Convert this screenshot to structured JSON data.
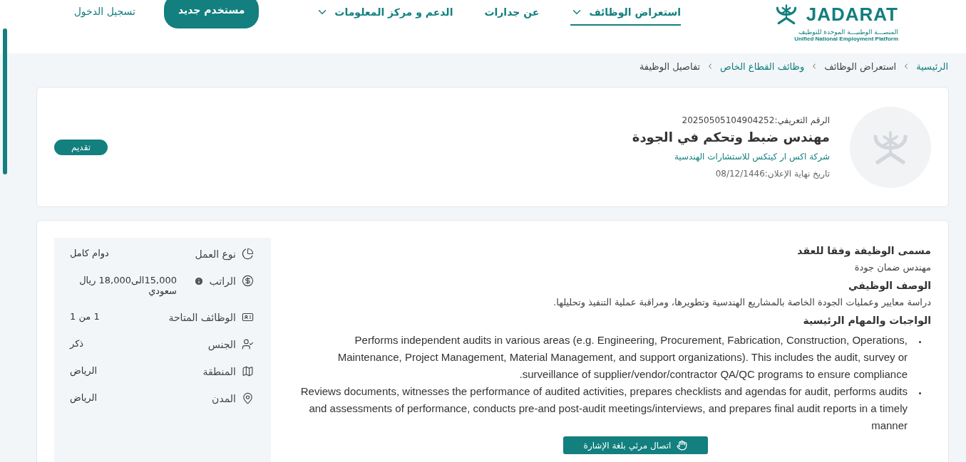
{
  "header": {
    "logo": {
      "wordmark": "JADARAT",
      "subtitle_ar": "المنصـــة الوطنيـــة الموحدة للتوظيف",
      "subtitle_en": "Unified National Employment Platform"
    },
    "nav": [
      {
        "label": "استعراض الوظائف",
        "selected": true,
        "dropdown": true
      },
      {
        "label": "عن جدارات",
        "selected": false,
        "dropdown": false
      },
      {
        "label": "الدعم و مركز المعلومات",
        "selected": false,
        "dropdown": true
      }
    ],
    "register_button": "مستخدم جديد",
    "login_link": "تسجيل الدخول"
  },
  "breadcrumb": [
    {
      "label": "الرئيسية",
      "kind": "link"
    },
    {
      "label": "استعراض الوظائف",
      "kind": "plain"
    },
    {
      "label": "وظائف القطاع الخاص",
      "kind": "link"
    },
    {
      "label": "تفاصيل الوظيفة",
      "kind": "current"
    }
  ],
  "job": {
    "reference": "الرقم التعريفي:20250505104904252",
    "title": "مهندس ضبط وتحكم في الجودة",
    "company": "شركة اكس ار كيتكس للاستشارات الهندسية",
    "deadline": "تاريخ نهاية الإعلان:08/12/1446",
    "apply_button": "تقديم"
  },
  "details": {
    "sections": [
      {
        "heading": "مسمى الوظيفة وفقا للعقد",
        "kind": "text",
        "text": "مهندس ضمان جودة"
      },
      {
        "heading": "الوصف الوظيفي",
        "kind": "text",
        "text": "دراسة معايير وعمليات الجودة الخاصة بالمشاريع الهندسية وتطويرها، ومراقبة عملية التنفيذ وتحليلها."
      },
      {
        "heading": "الواجبات والمهام الرئيسية",
        "kind": "bullets",
        "items": [
          "Performs independent audits in various areas (e.g. Engineering, Procurement, Fabrication, Construction, Operations, Maintenance, Project Management, Material Management, and support organizations). This includes the audit, survey or surveillance of supplier/vendor/contractor QA/QC programs to ensure compliance.",
          "Reviews documents, witnesses the performance of audited activities, prepares checklists and agendas for audit, performs audits and assessments of performance, conducts pre-and post-audit meetings/interviews, and prepares final audit reports in a timely manner"
        ]
      }
    ]
  },
  "summary": [
    {
      "kind": "work-type",
      "label": "نوع العمل",
      "value": "دوام كامل"
    },
    {
      "kind": "salary",
      "label": "الراتب",
      "value": "15,000الى18,000 ريال سعودي",
      "info": true
    },
    {
      "kind": "vacancies",
      "label": "الوظائف المتاحة",
      "value": "1 من 1"
    },
    {
      "kind": "gender",
      "label": "الجنس",
      "value": "ذكر"
    },
    {
      "kind": "region",
      "label": "المنطقة",
      "value": "الرياض"
    },
    {
      "kind": "city",
      "label": "المدن",
      "value": "الرياض"
    }
  ],
  "sign_language_button": "اتصال مرئي بلغة الإشارة"
}
